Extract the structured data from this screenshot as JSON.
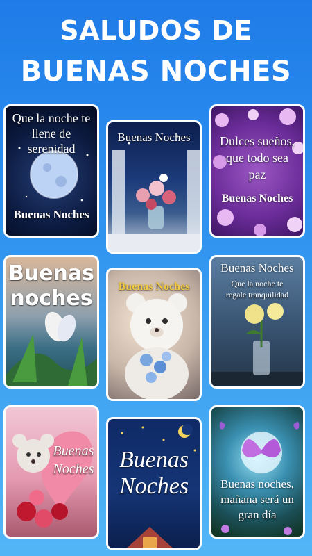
{
  "header": {
    "line1": "SALUDOS DE",
    "line2": "BUENAS NOCHES"
  },
  "cards": [
    {
      "lines": [
        "Que la noche te",
        "llene de",
        "serenidad"
      ],
      "footer": "Buenas Noches"
    },
    {
      "lines": [
        "Buenas Noches"
      ]
    },
    {
      "lines": [
        "Dulces sueños,",
        "que todo sea",
        "paz"
      ],
      "footer": "Buenas Noches"
    },
    {
      "lines": [
        "Buenas",
        "noches"
      ]
    },
    {
      "lines": [
        "Buenas Noches"
      ]
    },
    {
      "lines": [
        "Buenas Noches",
        "Que la noche te",
        "regale tranquilidad"
      ]
    },
    {
      "lines": [
        "Buenas",
        "Noches"
      ]
    },
    {
      "lines": [
        "Buenas",
        "Noches"
      ]
    },
    {
      "lines": [
        "Buenas noches,",
        "mañana será un",
        "gran día"
      ]
    }
  ],
  "colors": {
    "background_top": "#1f7be8",
    "background_bottom": "#52b6f6",
    "title": "#ffffff",
    "card_border": "#ffffff"
  }
}
